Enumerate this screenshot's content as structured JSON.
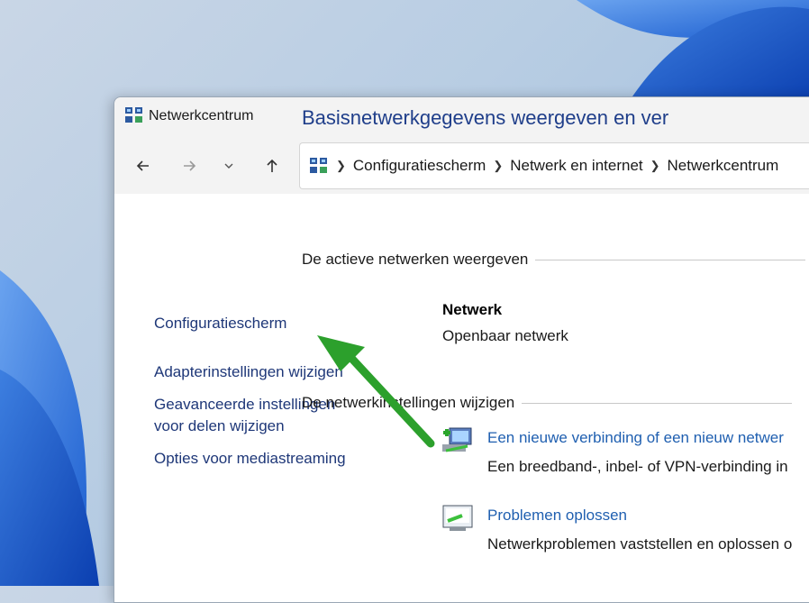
{
  "window": {
    "title": "Netwerkcentrum"
  },
  "address": {
    "crumbs": [
      "Configuratiescherm",
      "Netwerk en internet",
      "Netwerkcentrum"
    ]
  },
  "sidebar": {
    "items": [
      {
        "label": "Configuratiescherm"
      },
      {
        "label": "Adapterinstellingen wijzigen"
      },
      {
        "label_line1": "Geavanceerde instellingen",
        "label_line2": "voor delen wijzigen"
      },
      {
        "label": "Opties voor mediastreaming"
      }
    ]
  },
  "main": {
    "heading": "Basisnetwerkgegevens weergeven en ver",
    "active_section": "De actieve netwerken weergeven",
    "network": {
      "name": "Netwerk",
      "type": "Openbaar netwerk"
    },
    "change_section": "De netwerkinstellingen wijzigen",
    "tasks": [
      {
        "icon": "new-connection-icon",
        "link": "Een nieuwe verbinding of een nieuw netwer",
        "desc": "Een breedband-, inbel- of VPN-verbinding in"
      },
      {
        "icon": "troubleshoot-icon",
        "link": "Problemen oplossen",
        "desc": "Netwerkproblemen vaststellen en oplossen o"
      }
    ]
  },
  "colors": {
    "link": "#1f5fb0",
    "heading": "#1f3e8a",
    "arrow": "#2ca02c"
  }
}
